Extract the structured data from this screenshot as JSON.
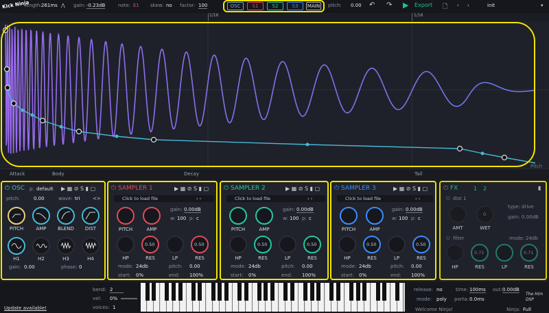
{
  "topbar": {
    "logo": "Kick Ninja",
    "length_label": "length:",
    "length_value": "261ms",
    "gain_label": "gain:",
    "gain_value": "-0.23dB",
    "note_label": "note:",
    "note_value": "E1",
    "skew_label": "skew:",
    "skew_value": "no",
    "factor_label": "factor:",
    "factor_value": "100",
    "tabs": [
      "OSC",
      "S1",
      "S2",
      "S3",
      "MAIN"
    ],
    "pitch_label": "pitch:",
    "pitch_value": "0.00",
    "export_label": "Export",
    "preset": "init"
  },
  "ruler": {
    "left": "1/16",
    "right": "1/16"
  },
  "stages": [
    "Attack",
    "Body",
    "Decay",
    "Tail"
  ],
  "pitch_label": "Pitch",
  "osc": {
    "title": "OSC",
    "p_label": "p:",
    "p_value": "default",
    "pitch_label": "pitch:",
    "pitch_value": "0.00",
    "wave_label": "wave:",
    "wave_value": "tri",
    "knobs_row1": [
      "PITCH",
      "AMP",
      "BLEND",
      "DIST"
    ],
    "knobs_row2": [
      "H1",
      "H2",
      "H3",
      "H4"
    ],
    "gain_label": "gain:",
    "gain_value": "0.00",
    "phase_label": "phase:",
    "phase_value": "0"
  },
  "samplers": [
    {
      "title": "SAMPLER 1",
      "color": "#e04b5a",
      "file": "Click to load file",
      "gain_label": "gain:",
      "gain_value": "0.00dB",
      "w_label": "w:",
      "w_value": "100",
      "p_label": "p:",
      "p_value": "c",
      "knobs_row1": [
        "PITCH",
        "AMP"
      ],
      "knobs_row2": [
        "HP",
        "RES",
        "LP",
        "RES"
      ],
      "res1": "0.50",
      "res2": "0.50",
      "mode_label": "mode:",
      "mode_value": "24db",
      "pitch_label": "pitch:",
      "pitch_value": "0.00",
      "start_label": "start:",
      "start_value": "0%",
      "end_label": "end:",
      "end_value": "100%"
    },
    {
      "title": "SAMPLER 2",
      "color": "#27c7a0",
      "file": "Click to load file",
      "gain_label": "gain:",
      "gain_value": "0.00dB",
      "w_label": "w:",
      "w_value": "100",
      "p_label": "p:",
      "p_value": "c",
      "knobs_row1": [
        "PITCH",
        "AMP"
      ],
      "knobs_row2": [
        "HP",
        "RES",
        "LP",
        "RES"
      ],
      "res1": "0.50",
      "res2": "0.50",
      "mode_label": "mode:",
      "mode_value": "24db",
      "pitch_label": "pitch:",
      "pitch_value": "0.00",
      "start_label": "start:",
      "start_value": "0%",
      "end_label": "end:",
      "end_value": "100%"
    },
    {
      "title": "SAMPLER 3",
      "color": "#3d8cff",
      "file": "Click to load file",
      "gain_label": "gain:",
      "gain_value": "0.00dB",
      "w_label": "w:",
      "w_value": "100",
      "p_label": "p:",
      "p_value": "c",
      "knobs_row1": [
        "PITCH",
        "AMP"
      ],
      "knobs_row2": [
        "HP",
        "RES",
        "LP",
        "RES"
      ],
      "res1": "0.50",
      "res2": "0.50",
      "mode_label": "mode:",
      "mode_value": "24db",
      "pitch_label": "pitch:",
      "pitch_value": "0.00",
      "start_label": "start:",
      "start_value": "0%",
      "end_label": "end:",
      "end_value": "100%"
    }
  ],
  "fx": {
    "title": "FX",
    "tab1": "1",
    "tab2": "2",
    "dist_label": "dist 1",
    "type_label": "type:",
    "type_value": "drive",
    "gain_label": "gain:",
    "gain_value": "0.00dB",
    "amt": "AMT",
    "wet": "WET",
    "wet_value": "0",
    "filter_label": "filter",
    "mode_label": "mode:",
    "mode_value": "24db",
    "knobs": [
      "HP",
      "RES",
      "LP",
      "RES"
    ],
    "res1": "0.71",
    "res2": "0.71"
  },
  "bottom": {
    "update": "Update available!",
    "bend_label": "bend:",
    "bend_value": "2",
    "vel_label": "vel:",
    "vel_value": "0%",
    "voices_label": "voices:",
    "voices_value": "1",
    "release_label": "release:",
    "release_value": "no",
    "mode_label": "mode:",
    "mode_value": "poly",
    "time_label": "time:",
    "time_value": "100ms",
    "porta_label": "porta:",
    "porta_value": "0.0ms",
    "out_label": "out:",
    "out_value": "0.00dB",
    "welcome": "Welcome Ninja!",
    "ninja_label": "Ninja:",
    "ninja_value": "Full",
    "brand": "The Him DSP"
  }
}
